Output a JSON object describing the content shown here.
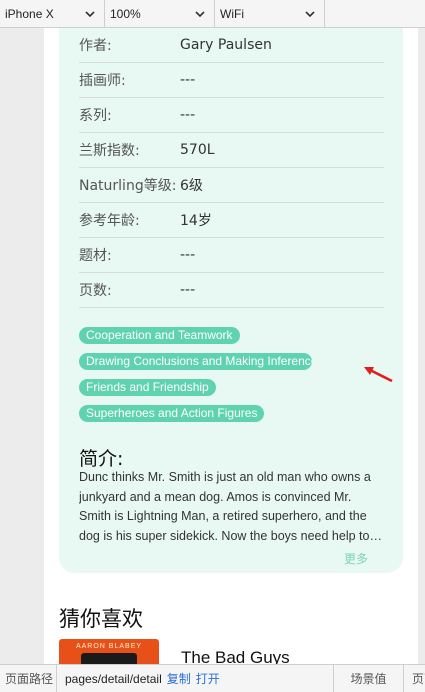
{
  "toolbar": {
    "device": "iPhone X",
    "zoom": "100%",
    "network": "WiFi"
  },
  "details": [
    {
      "label": "作者:",
      "value": "Gary Paulsen"
    },
    {
      "label": "插画师:",
      "value": "---"
    },
    {
      "label": "系列:",
      "value": "---"
    },
    {
      "label": "兰斯指数:",
      "value": "570L"
    },
    {
      "label": "Naturling等级:",
      "value": "6级"
    },
    {
      "label": "参考年龄:",
      "value": "14岁"
    },
    {
      "label": "题材:",
      "value": "---"
    },
    {
      "label": "页数:",
      "value": "---"
    }
  ],
  "tags": [
    "Cooperation and Teamwork",
    "Drawing Conclusions and Making Inferences",
    "Friends and Friendship",
    "Superheroes and Action Figures"
  ],
  "intro": {
    "title": "简介:",
    "text": "Dunc thinks Mr. Smith is just an old man who owns a junkyard and a mean dog. Amos is convinced Mr. Smith is Lightning Man, a retired superhero, and the dog is his super sidekick. Now the boys need help to…",
    "more": "更多"
  },
  "recommend": {
    "title": "猜你喜欢",
    "book_title": "The Bad Guys",
    "cover_author": "AARON BLABEY"
  },
  "statusbar": {
    "path_label": "页面路径",
    "path": "pages/detail/detail",
    "copy": "复制",
    "open": "打开",
    "scene": "场景值",
    "page_params": "页面参数"
  },
  "colors": {
    "accent": "#5fd3b0",
    "card_bg": "#e8f8f2",
    "arrow": "#e02020"
  }
}
